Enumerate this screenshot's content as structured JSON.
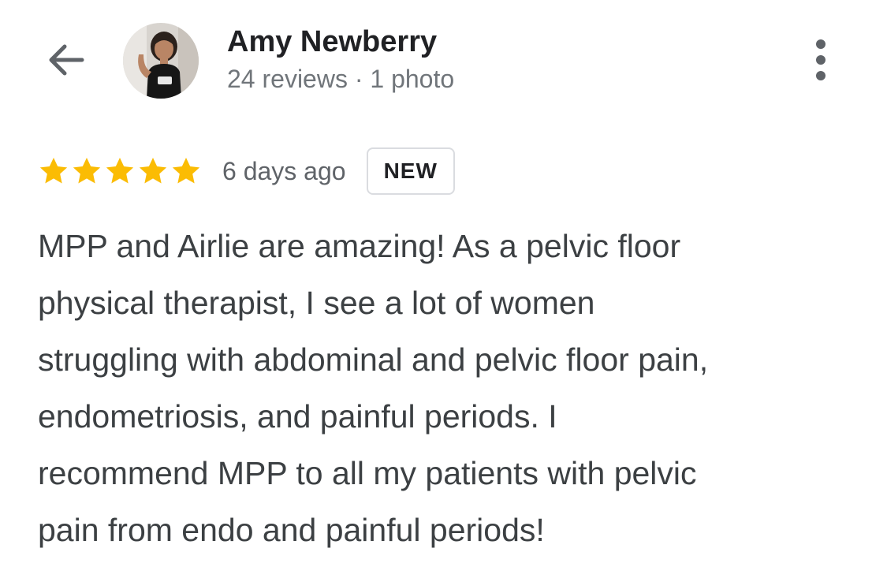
{
  "header": {
    "back_icon": "arrow-left-icon",
    "avatar_icon": "profile-photo",
    "reviewer_name": "Amy Newberry",
    "reviewer_meta": "24 reviews · 1 photo",
    "more_icon": "more-vertical-icon"
  },
  "rating": {
    "stars": 5,
    "max_stars": 5,
    "star_color": "#fbbc04",
    "date": "6 days ago",
    "badge": "NEW"
  },
  "review": {
    "lines": [
      "MPP and Airlie are amazing! As a pelvic floor",
      "physical therapist, I see a lot of women",
      "struggling with abdominal and pelvic floor pain,",
      "endometriosis, and painful periods. I",
      "recommend MPP to all my patients with pelvic",
      "pain from endo and painful periods!"
    ]
  },
  "colors": {
    "name_text": "#202124",
    "meta_text": "#70757a",
    "body_text": "#3c4043",
    "icon": "#5f6368",
    "badge_border": "#dadce0"
  }
}
